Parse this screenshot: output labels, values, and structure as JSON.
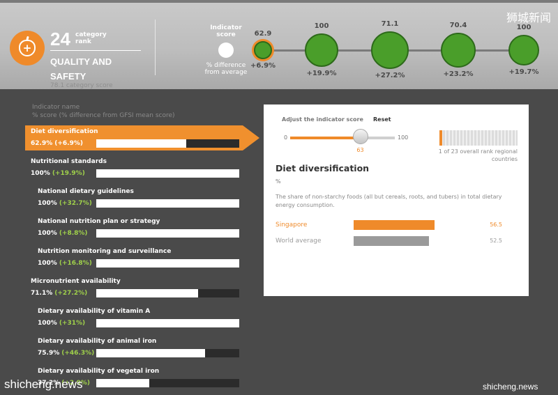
{
  "header": {
    "rank": "24",
    "rank_label": "category rank",
    "category_title": "QUALITY AND SAFETY",
    "category_score": "78.1 category score",
    "indicator_score_label": "Indicator score",
    "pct_diff_label": "% difference from average",
    "scores": [
      {
        "value": "62.9",
        "diff": "+6.9%",
        "selected": true
      },
      {
        "value": "100",
        "diff": "+19.9%",
        "selected": false
      },
      {
        "value": "71.1",
        "diff": "+27.2%",
        "selected": false
      },
      {
        "value": "70.4",
        "diff": "+23.2%",
        "selected": false
      },
      {
        "value": "100",
        "diff": "+19.7%",
        "selected": false
      }
    ],
    "watermark": "狮城新闻"
  },
  "list": {
    "header_line1": "Indicator name",
    "header_line2": "% score (% difference from GFSI mean score)",
    "items": [
      {
        "name": "Diet diversification",
        "pct": "62.9%",
        "diff": "(+6.9%)",
        "fill": 0.63,
        "indent": false,
        "active": true
      },
      {
        "name": "Nutritional standards",
        "pct": "100%",
        "diff": "(+19.9%)",
        "fill": 1.0,
        "indent": false,
        "active": false
      },
      {
        "name": "National dietary guidelines",
        "pct": "100%",
        "diff": "(+32.7%)",
        "fill": 1.0,
        "indent": true,
        "active": false
      },
      {
        "name": "National nutrition plan or strategy",
        "pct": "100%",
        "diff": "(+8.8%)",
        "fill": 1.0,
        "indent": true,
        "active": false
      },
      {
        "name": "Nutrition monitoring and surveillance",
        "pct": "100%",
        "diff": "(+16.8%)",
        "fill": 1.0,
        "indent": true,
        "active": false
      },
      {
        "name": "Micronutrient availability",
        "pct": "71.1%",
        "diff": "(+27.2%)",
        "fill": 0.71,
        "indent": false,
        "active": false
      },
      {
        "name": "Dietary availability of vitamin A",
        "pct": "100%",
        "diff": "(+31%)",
        "fill": 1.0,
        "indent": true,
        "active": false
      },
      {
        "name": "Dietary availability of animal iron",
        "pct": "75.9%",
        "diff": "(+46.3%)",
        "fill": 0.76,
        "indent": true,
        "active": false
      },
      {
        "name": "Dietary availability of vegetal iron",
        "pct": "37.2%",
        "diff": "(+2.9%)",
        "fill": 0.37,
        "indent": true,
        "active": false
      }
    ]
  },
  "panel": {
    "adjust_label": "Adjust the indicator score",
    "reset_label": "Reset",
    "slider_min": "0",
    "slider_max": "100",
    "slider_value": "63",
    "slider_level": 0.63,
    "rank_text": "1 of 23 overall rank regional countries",
    "title": "Diet diversification",
    "unit": "%",
    "description": "The share of non-starchy foods (all but cereals, roots, and tubers) in total dietary energy consumption.",
    "comparisons": [
      {
        "label": "Singapore",
        "value": "56.5",
        "level": 0.565,
        "color": "#ef8a2a"
      },
      {
        "label": "World average",
        "value": "52.5",
        "level": 0.525,
        "color": "#9a9a9a"
      }
    ]
  },
  "watermarks": {
    "bottom_left": "shicheng.news",
    "bottom_right": "shicheng.news"
  }
}
